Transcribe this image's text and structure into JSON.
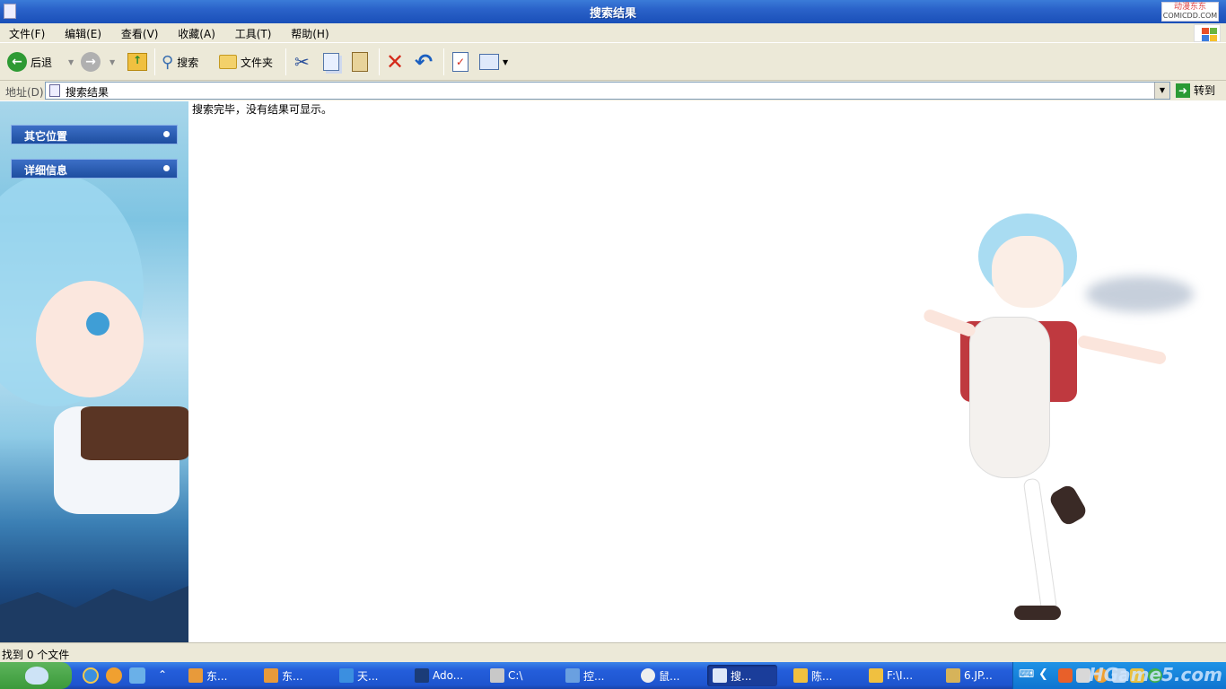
{
  "window": {
    "title": "搜索结果",
    "brand": "动漫东东",
    "brand_sub": "COMICDD.COM"
  },
  "menu": [
    "文件(F)",
    "编辑(E)",
    "查看(V)",
    "收藏(A)",
    "工具(T)",
    "帮助(H)"
  ],
  "toolbar": {
    "back_label": "后退",
    "search_label": "搜索",
    "folders_label": "文件夹"
  },
  "address": {
    "label": "地址(D)",
    "value": "搜索结果",
    "go_label": "转到"
  },
  "sidebar": {
    "items": [
      {
        "label": "其它位置"
      },
      {
        "label": "详细信息"
      }
    ]
  },
  "content": {
    "message": "搜索完毕，没有结果可显示。"
  },
  "status": {
    "text": "找到 0 个文件"
  },
  "taskbar": {
    "tasks": [
      {
        "label": "东...",
        "icon": "people-icon",
        "color": "#e89a3a"
      },
      {
        "label": "东...",
        "icon": "people-icon",
        "color": "#e89a3a"
      },
      {
        "label": "天...",
        "icon": "ie-icon",
        "color": "#3b8fe0"
      },
      {
        "label": "Ado...",
        "icon": "photoshop-icon",
        "color": "#1b3c78"
      },
      {
        "label": "C:\\",
        "icon": "drive-icon",
        "color": "#c8c8c8"
      },
      {
        "label": "控...",
        "icon": "control-panel-icon",
        "color": "#6aa0e0"
      },
      {
        "label": "鼠...",
        "icon": "mouse-icon",
        "color": "#eeeeee"
      },
      {
        "label": "搜...",
        "icon": "search-window-icon",
        "color": "#dfe8f8"
      },
      {
        "label": "陈...",
        "icon": "folder-icon",
        "color": "#f0c040"
      },
      {
        "label": "F:\\I...",
        "icon": "folder-icon",
        "color": "#f0c040"
      },
      {
        "label": "6.JP...",
        "icon": "image-icon",
        "color": "#d6b35a"
      }
    ],
    "watermark": "HGame5.com"
  }
}
